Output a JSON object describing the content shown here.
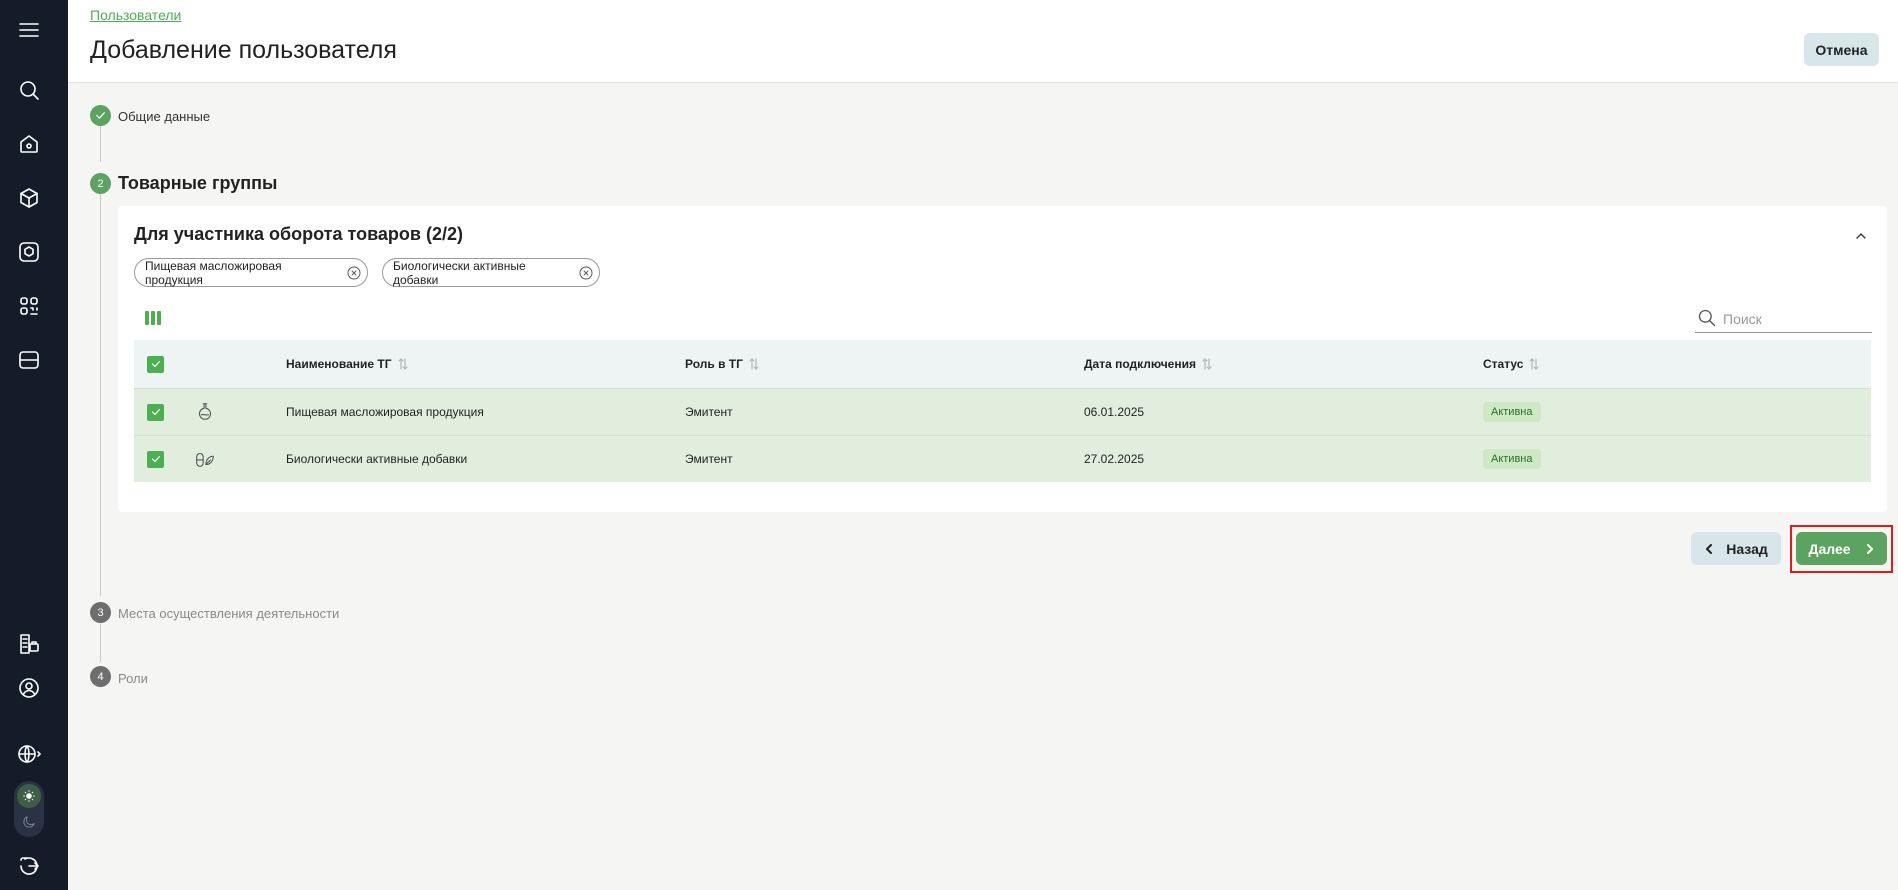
{
  "header": {
    "breadcrumb": "Пользователи",
    "title": "Добавление пользователя",
    "cancel_label": "Отмена"
  },
  "steps": [
    {
      "number": "1",
      "label": "Общие данные",
      "state": "done"
    },
    {
      "number": "2",
      "label": "Товарные группы",
      "state": "active"
    },
    {
      "number": "3",
      "label": "Места осуществления деятельности",
      "state": "todo"
    },
    {
      "number": "4",
      "label": "Роли",
      "state": "todo"
    }
  ],
  "card": {
    "title": "Для участника оборота товаров (2/2)",
    "chips": [
      "Пищевая масложировая продукция",
      "Биологически активные добавки"
    ],
    "search_placeholder": "Поиск"
  },
  "table": {
    "columns": [
      "Наименование ТГ",
      "Роль в ТГ",
      "Дата подключения",
      "Статус"
    ],
    "rows": [
      {
        "name": "Пищевая масложировая продукция",
        "role": "Эмитент",
        "date": "06.01.2025",
        "status": "Активна",
        "icon": "flask-icon",
        "checked": true
      },
      {
        "name": "Биологически активные добавки",
        "role": "Эмитент",
        "date": "27.02.2025",
        "status": "Активна",
        "icon": "pills-leaf-icon",
        "checked": true
      }
    ]
  },
  "footer": {
    "back_label": "Назад",
    "next_label": "Далее"
  },
  "colors": {
    "accent": "#5ba35f",
    "sidebar": "#141c2a",
    "highlight": "#e01b1b"
  }
}
